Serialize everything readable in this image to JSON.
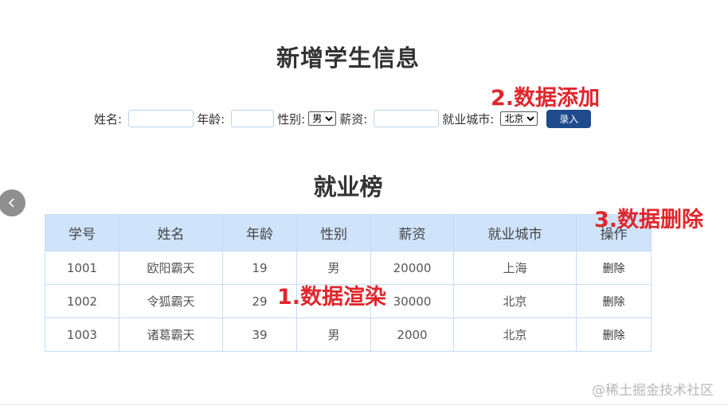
{
  "form": {
    "title": "新增学生信息",
    "name_label": "姓名:",
    "age_label": "年龄:",
    "gender_label": "性别:",
    "gender_value": "男",
    "salary_label": "薪资:",
    "city_label": "就业城市:",
    "city_value": "北京",
    "submit_label": "录入"
  },
  "annotations": {
    "add": "2.数据添加",
    "delete": "3.数据删除",
    "render": "1.数据渲染"
  },
  "list": {
    "title": "就业榜",
    "columns": [
      "学号",
      "姓名",
      "年龄",
      "性别",
      "薪资",
      "就业城市",
      "操作"
    ],
    "rows": [
      {
        "id": "1001",
        "name": "欧阳霸天",
        "age": "19",
        "gender": "男",
        "salary": "20000",
        "city": "上海",
        "op": "删除"
      },
      {
        "id": "1002",
        "name": "令狐霸天",
        "age": "29",
        "gender": "",
        "salary": "30000",
        "city": "北京",
        "op": "删除"
      },
      {
        "id": "1003",
        "name": "诸葛霸天",
        "age": "39",
        "gender": "男",
        "salary": "2000",
        "city": "北京",
        "op": "删除"
      }
    ]
  },
  "watermark": "@稀土掘金技术社区",
  "icons": {
    "back": "chevron-left-icon"
  }
}
